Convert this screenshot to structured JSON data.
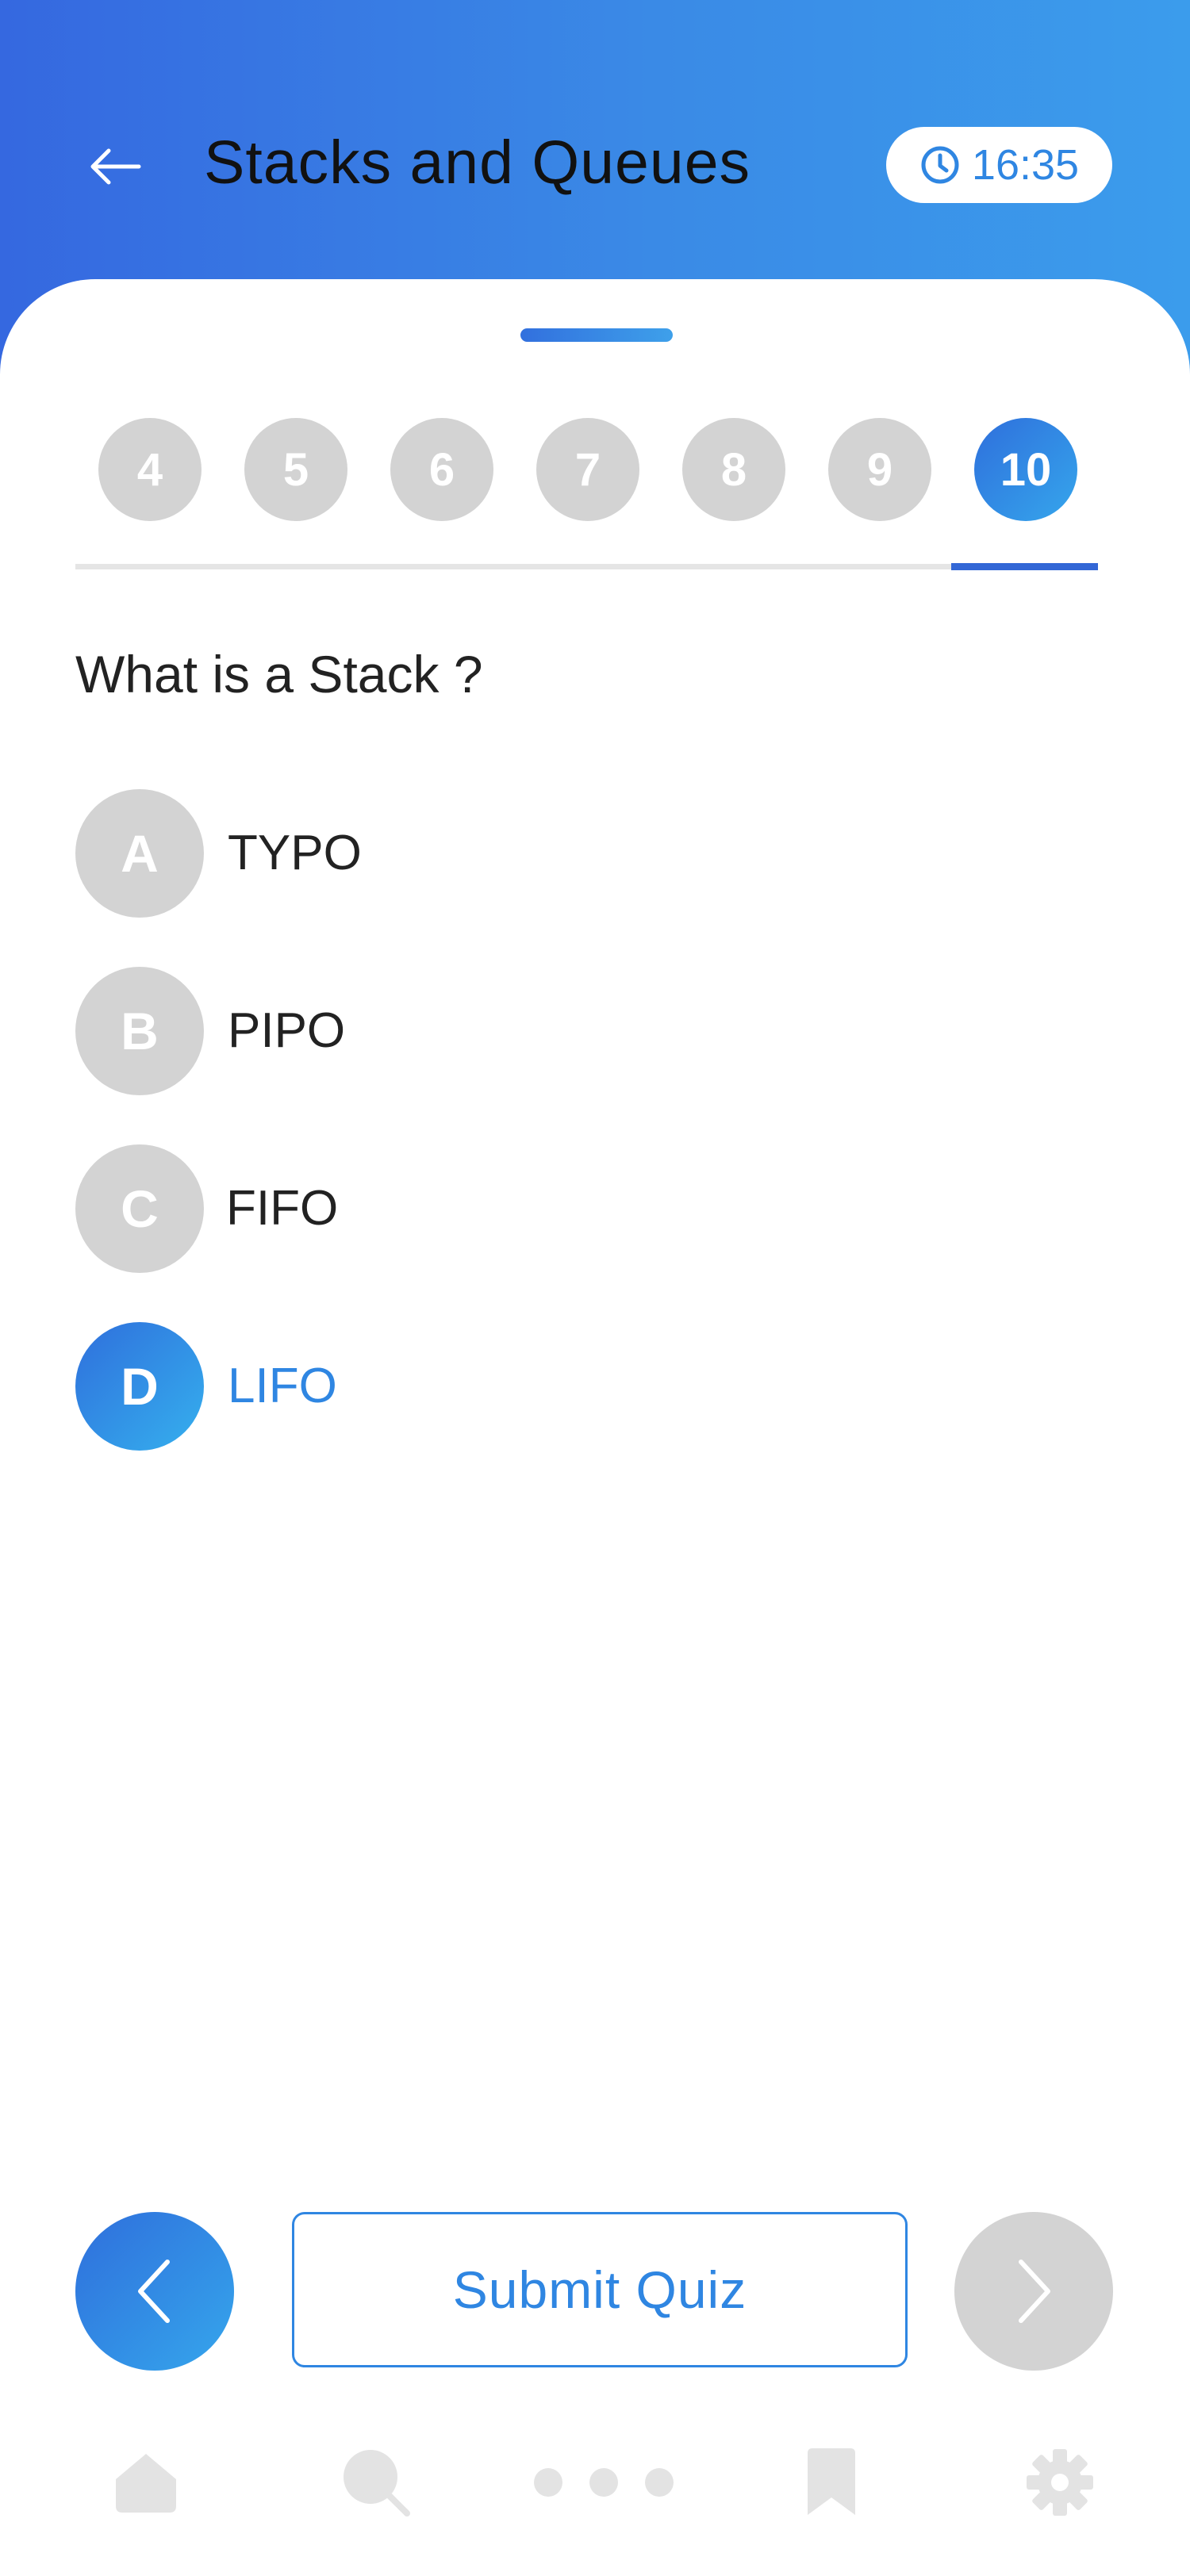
{
  "header": {
    "title": "Stacks and Queues",
    "timer": "16:35",
    "back_icon": "arrow-left-icon",
    "timer_icon": "clock-icon"
  },
  "question_nav": {
    "numbers": [
      "4",
      "5",
      "6",
      "7",
      "8",
      "9",
      "10"
    ],
    "active": "10"
  },
  "question": {
    "text": "What is a Stack ?",
    "options": [
      {
        "letter": "A",
        "text": "TYPO"
      },
      {
        "letter": "B",
        "text": "PIPO"
      },
      {
        "letter": "C",
        "text": "FIFO"
      },
      {
        "letter": "D",
        "text": "LIFO"
      }
    ],
    "selected": "D"
  },
  "footer": {
    "submit_label": "Submit Quiz",
    "prev_icon": "chevron-left-icon",
    "next_icon": "chevron-right-icon"
  },
  "bottom_nav": {
    "items": [
      "home-icon",
      "search-icon",
      "more-icon",
      "bookmark-icon",
      "settings-icon"
    ]
  },
  "colors": {
    "accent": "#2f86e2",
    "header_gradient_start": "#3568e0",
    "header_gradient_end": "#3b9cec",
    "inactive": "#d3d3d3",
    "nav_icon": "#e3e3e3"
  }
}
